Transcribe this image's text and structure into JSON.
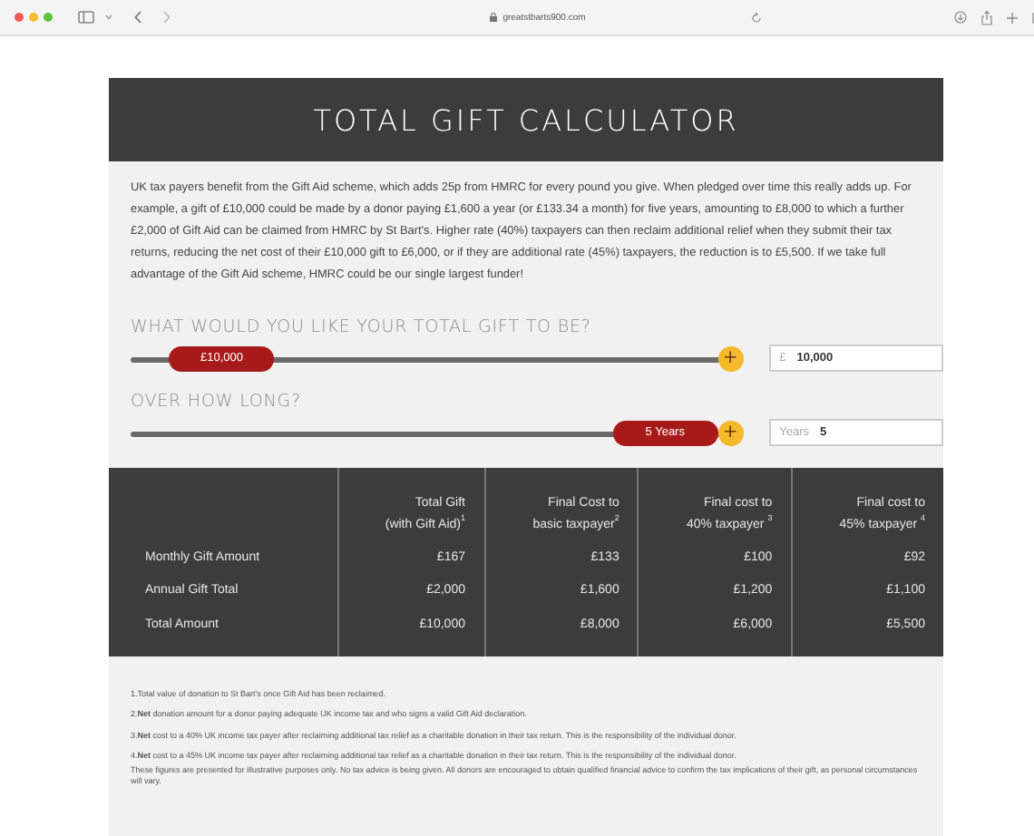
{
  "browser": {
    "url": "greatstbarts900.com"
  },
  "title": "TOTAL GIFT CALCULATOR",
  "intro": "UK tax payers benefit from the Gift Aid scheme, which adds 25p from HMRC for every pound you give. When pledged over time this really adds up.  For example, a gift of £10,000 could be made by a donor paying £1,600 a year (or £133.34 a month) for five years, amounting to £8,000 to which a further £2,000 of Gift Aid can be claimed from HMRC by St Bart's. Higher rate (40%) taxpayers can then reclaim additional relief when they submit their tax returns, reducing the net cost of their £10,000 gift to £6,000, or if they are additional rate (45%) taxpayers, the reduction is to £5,500. If we take full advantage of the Gift Aid scheme, HMRC could be our single largest funder!",
  "sliders": [
    {
      "question": "WHAT WOULD YOU LIKE YOUR TOTAL GIFT TO BE?",
      "thumb": "£10,000",
      "level": 0.08,
      "button": "+",
      "prefix": "£",
      "value": "10,000"
    },
    {
      "question": "OVER HOW LONG?",
      "thumb": "5 Years",
      "level": 1,
      "button": "+",
      "prefix": "Years",
      "value": "5"
    }
  ],
  "table": {
    "columns": [
      "Total Gift\n(with Gift Aid)$^{1}$",
      "Final Cost to\nbasic taxpayer$^{2}$",
      "Final cost to\n40% taxpayer $^{3}$",
      "Final cost to\n45% taxpayer $^{4}$"
    ],
    "rows": [
      {
        "label": "Monthly Gift Amount",
        "cells": [
          "£167",
          "£133",
          "£100",
          "£92"
        ]
      },
      {
        "label": "Annual Gift Total",
        "cells": [
          "£2,000",
          "£1,600",
          "£1,200",
          "£1,100"
        ]
      },
      {
        "label": "Total Amount",
        "cells": [
          "£10,000",
          "£8,000",
          "£6,000",
          "£5,500"
        ]
      }
    ]
  },
  "footnotes": [
    "1.Total value of donation to St Bart's once Gift Aid has been reclaimed.",
    "2.**Net** donation amount for a donor paying adequate UK income tax and who signs a valid Gift Aid declaration.",
    "3.**Net** cost to a 40% UK income tax payer after reclaiming additional tax relief as a charitable donation in their tax return. This is the responsibility of the individual donor.",
    "4.**Net** cost to a 45% UK income tax payer after reclaiming additional tax relief as a charitable donation in their tax return. This is the responsibility of the individual donor."
  ],
  "disclaimer": "These figures are presented for illustrative purposes only. No tax advice is being given. All donors are encouraged to obtain qualified financial advice to confirm the tax implications of their gift, as personal circumstances will vary."
}
